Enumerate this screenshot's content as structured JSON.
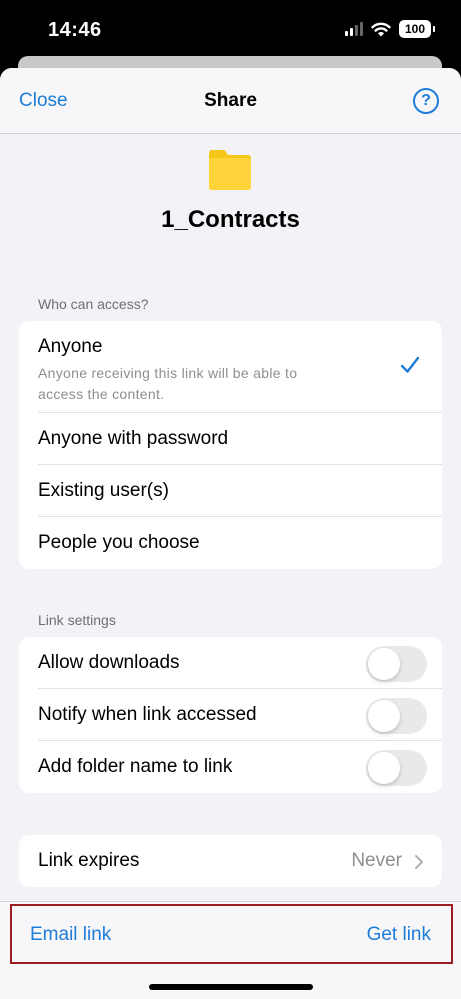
{
  "status": {
    "time": "14:46",
    "battery": "100"
  },
  "nav": {
    "close_label": "Close",
    "title": "Share",
    "help_label": "?"
  },
  "folder": {
    "name": "1_Contracts",
    "icon": "folder-icon",
    "color": "#FFD43B"
  },
  "access": {
    "section_label": "Who can access?",
    "options": [
      {
        "label": "Anyone",
        "description": "Anyone receiving this link will be able to access the content.",
        "selected": true
      },
      {
        "label": "Anyone with password",
        "selected": false
      },
      {
        "label": "Existing user(s)",
        "selected": false
      },
      {
        "label": "People you choose",
        "selected": false
      }
    ]
  },
  "link_settings": {
    "section_label": "Link settings",
    "items": [
      {
        "label": "Allow downloads",
        "enabled": false
      },
      {
        "label": "Notify when link accessed",
        "enabled": false
      },
      {
        "label": "Add folder name to link",
        "enabled": false
      }
    ]
  },
  "expiry": {
    "label": "Link expires",
    "value": "Never"
  },
  "actions": {
    "email_link": "Email link",
    "get_link": "Get link"
  },
  "colors": {
    "accent": "#1E7CD8",
    "highlight_border": "#9B1C22"
  }
}
